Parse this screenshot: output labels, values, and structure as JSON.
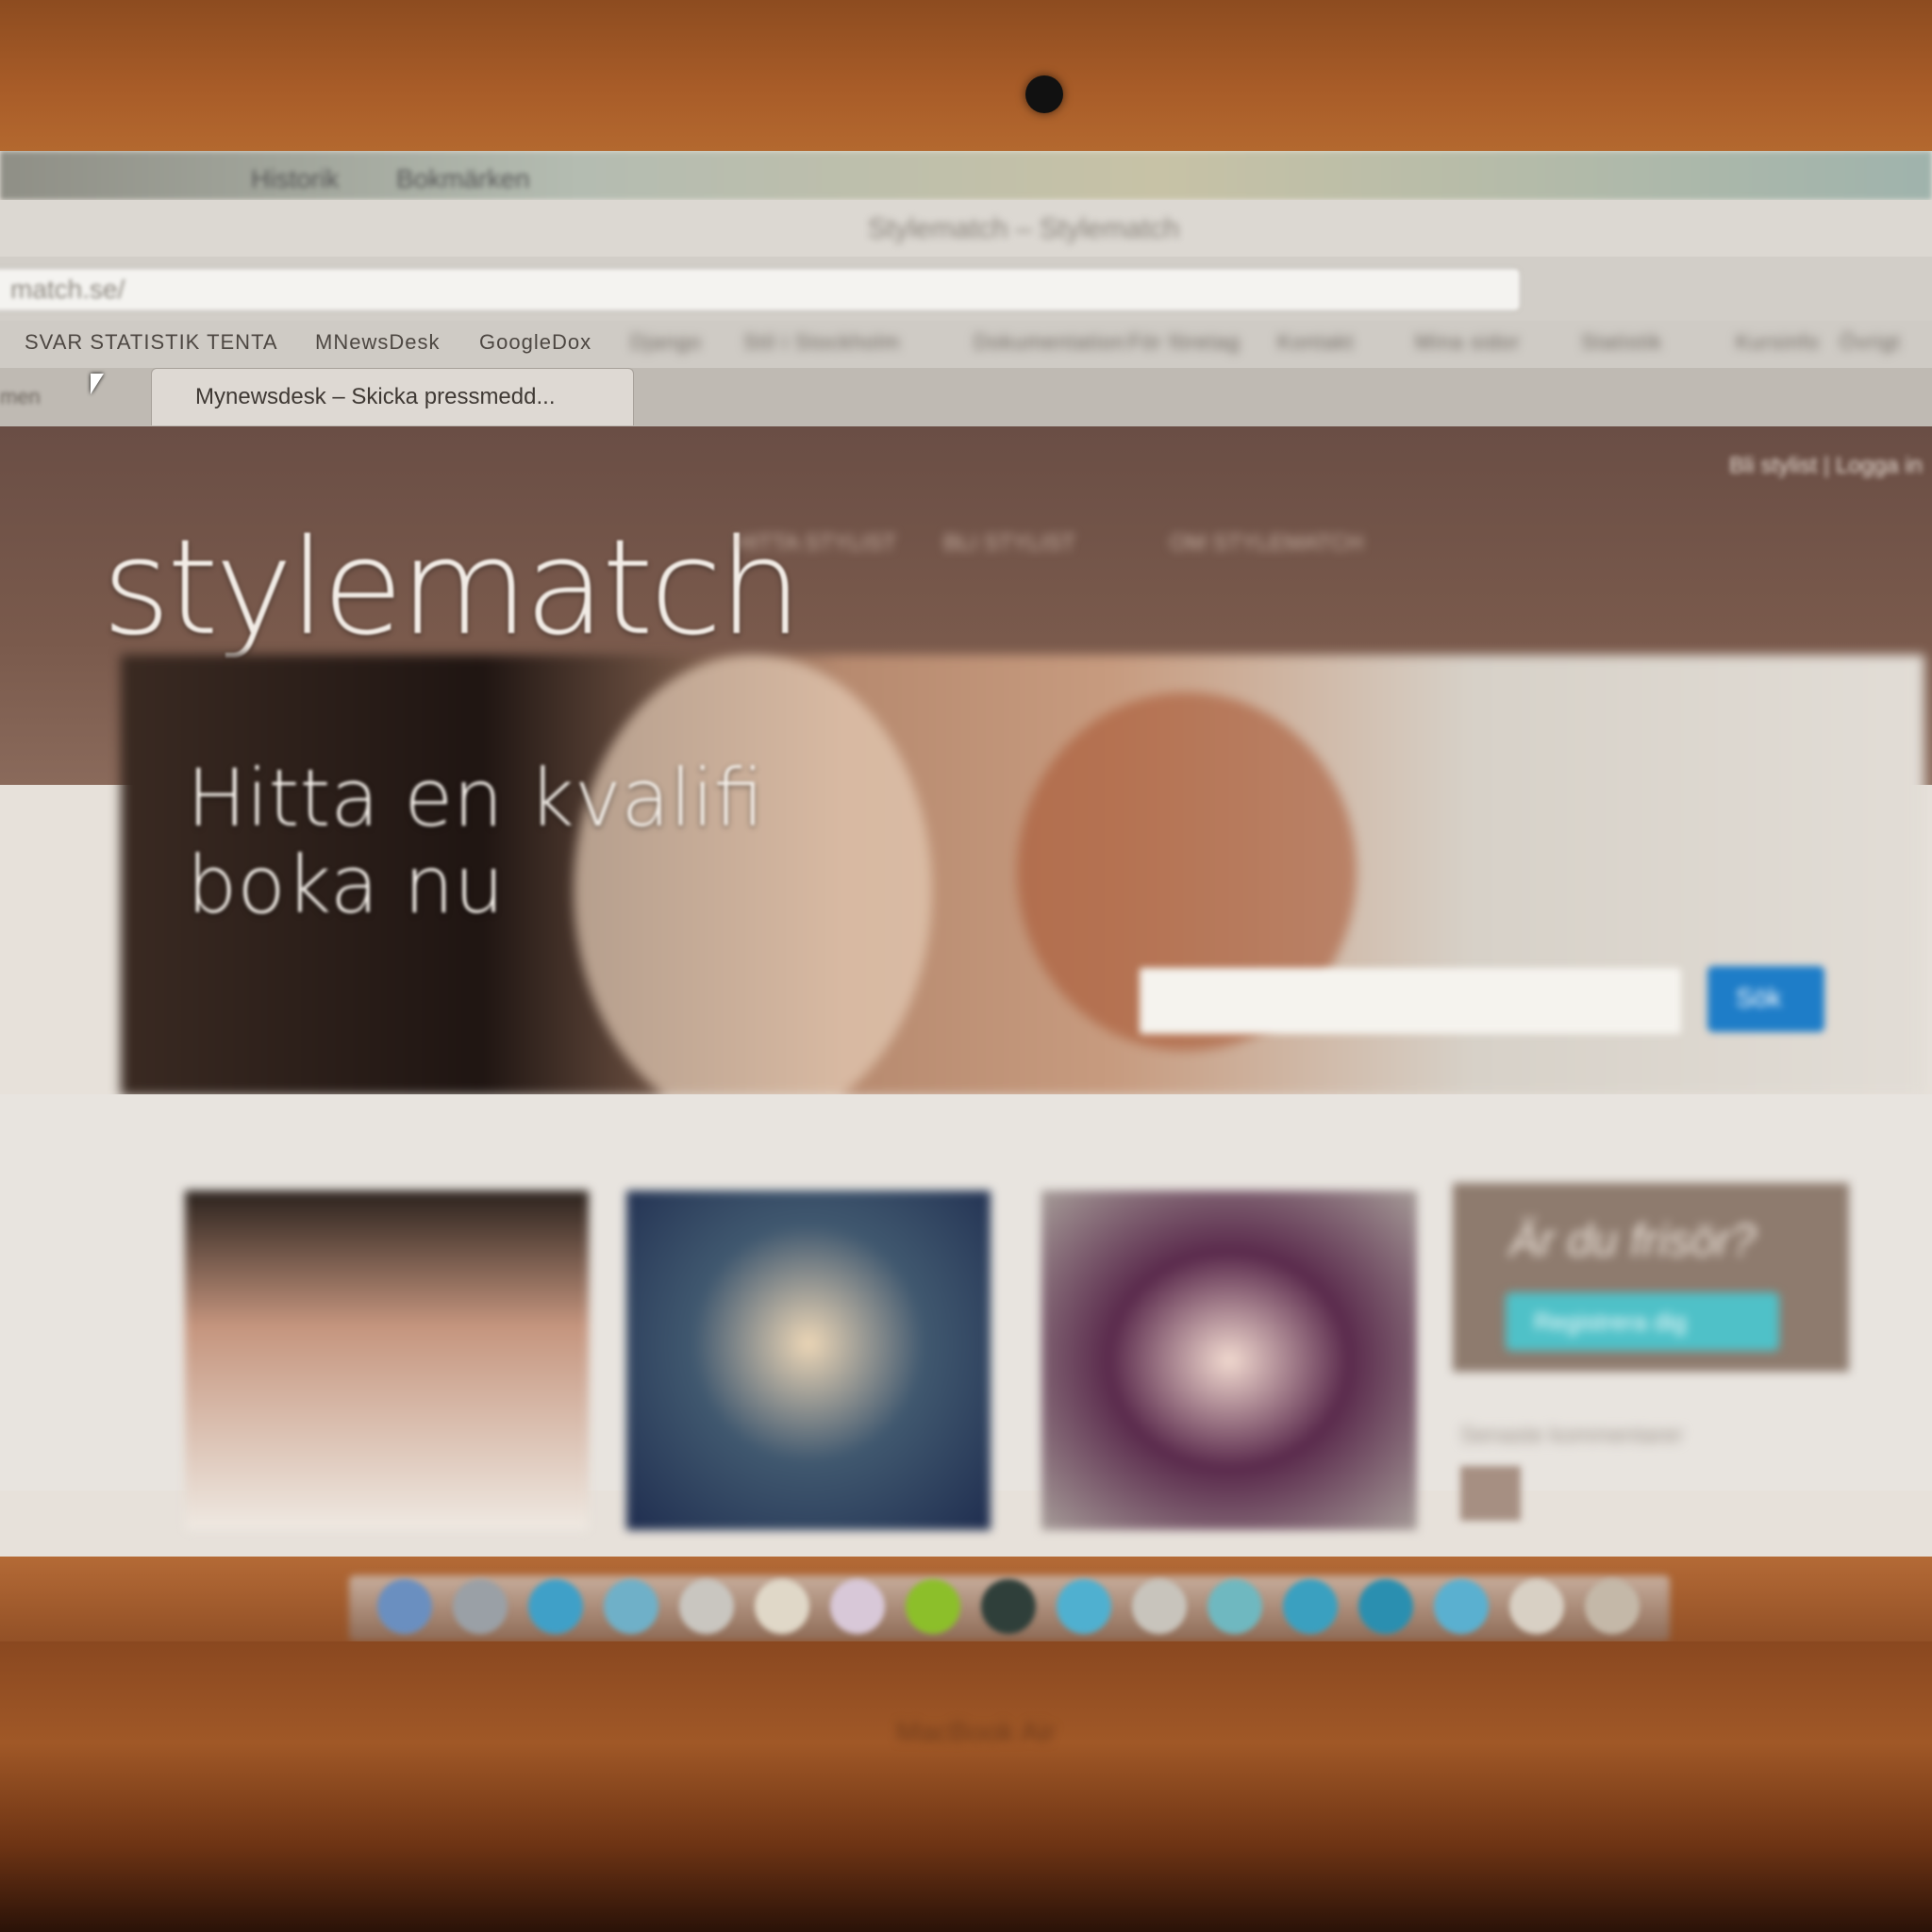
{
  "os_menubar": {
    "items": [
      "Historik",
      "Bokmärken"
    ]
  },
  "browser": {
    "window_title": "Stylematch – Stylematch",
    "url": "match.se/",
    "bookmarks": [
      "SVAR STATISTIK TENTA",
      "MNewsDesk",
      "GoogleDox",
      "Django",
      "Stil i Stockholm",
      "Dokumentation",
      "För företag",
      "Kontakt",
      "Mina sidor",
      "Statistik",
      "Kursinfo",
      "Övrigt"
    ],
    "tab_left_label": "men",
    "active_tab": "Mynewsdesk – Skicka pressmedd..."
  },
  "site": {
    "logo": "stylematch",
    "login": "Bli stylist | Logga in",
    "nav": [
      "HITTA STYLIST",
      "BLI STYLIST",
      "OM STYLEMATCH"
    ],
    "hero_line1": "Hitta en kvalifi",
    "hero_line2": "boka nu",
    "search_button": "Sök",
    "promo_title": "Är du frisör?",
    "promo_button": "Registrera dig",
    "sidebar_text": "Senaste kommentarer"
  },
  "laptop_label": "MacBook Air",
  "colors": {
    "header_bg": "#6a4e45",
    "search_button": "#1e7dc8",
    "promo_button": "#4fc1c8"
  }
}
